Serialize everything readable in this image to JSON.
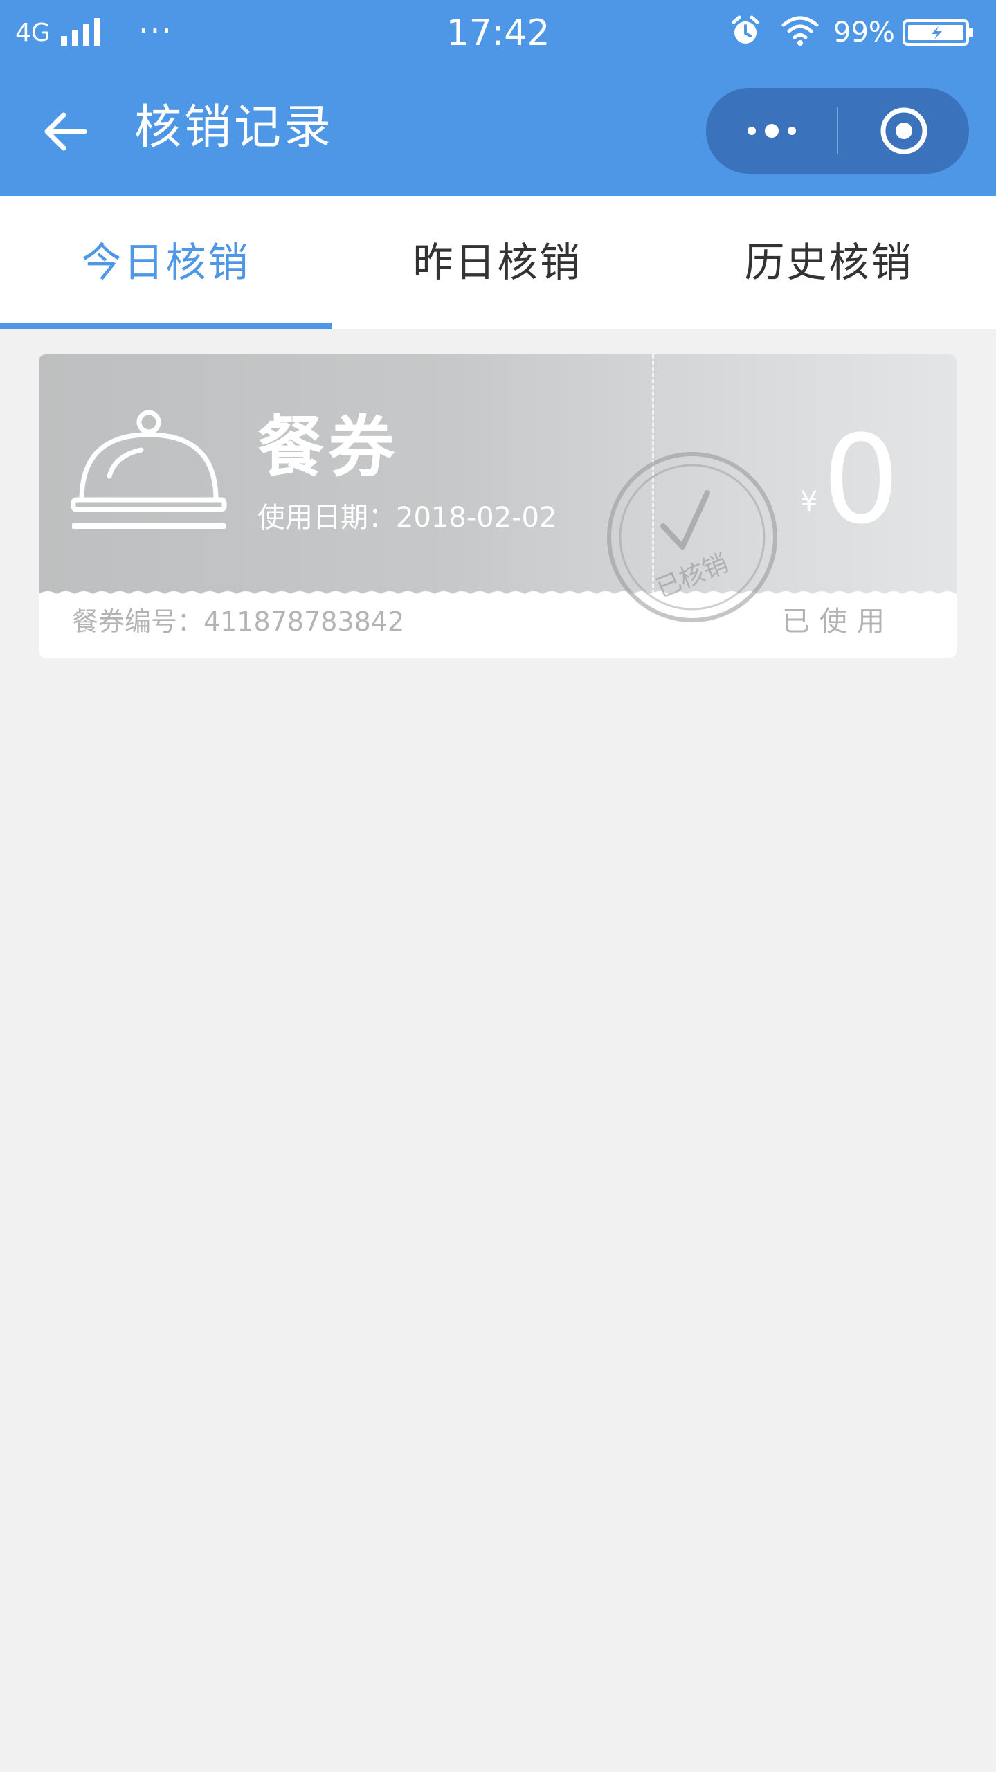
{
  "status_bar": {
    "network": "4G",
    "more_dots": "···",
    "time": "17:42",
    "battery_percent": "99%",
    "icons": [
      "signal-icon",
      "alarm-icon",
      "wifi-icon",
      "battery-charging-icon"
    ]
  },
  "nav": {
    "title": "核销记录",
    "back_icon": "arrow-left-icon",
    "capsule_icons": [
      "more-dots-icon",
      "target-close-icon"
    ]
  },
  "tabs": [
    {
      "label": "今日核销",
      "active": true
    },
    {
      "label": "昨日核销",
      "active": false
    },
    {
      "label": "历史核销",
      "active": false
    }
  ],
  "coupon": {
    "icon": "cloche-icon",
    "title": "餐券",
    "date_label": "使用日期：2018-02-02",
    "currency_symbol": "¥",
    "amount": "0",
    "stamp_text": "已核销",
    "number_label": "餐券编号：411878783842",
    "status": "已使用"
  },
  "colors": {
    "primary": "#4d97e6",
    "capsule": "#3a73bc",
    "background": "#f1f1f1",
    "muted_text": "#b3b3b3"
  }
}
